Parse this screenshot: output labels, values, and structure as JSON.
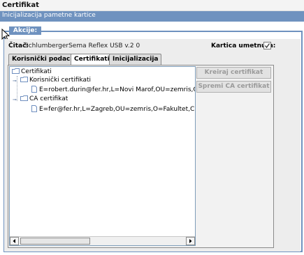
{
  "window": {
    "title": "Certifikat"
  },
  "header": {
    "title": "Inicijalizacija pametne kartice"
  },
  "group": {
    "label": "Akcije:"
  },
  "reader": {
    "label": "Čitač:",
    "value": "SchlumbergerSema Reflex USB v.2 0"
  },
  "card_inserted": {
    "label": "Kartica umetnuta:",
    "checked": true
  },
  "tabs": [
    {
      "label": "Korisnički podaci",
      "active": false
    },
    {
      "label": "Certifikati",
      "active": true
    },
    {
      "label": "Inicijalizacija",
      "active": false
    }
  ],
  "tree": {
    "root": "Certifikati",
    "user_folder": "Korisnički certifikati",
    "user_cert": "E=robert.durin@fer.hr,L=Novi Marof,OU=zemris,O=fer,C=",
    "ca_folder": "CA certifikat",
    "ca_cert": "E=fer@fer.hr,L=Zagreb,OU=zemris,O=Fakultet,C=HR,CN"
  },
  "buttons": {
    "create_cert": "Kreiraj certifikat",
    "save_ca_cert": "Spremi CA certifikat"
  },
  "colors": {
    "accent": "#6f92bf",
    "folder": "#6f8fbf"
  }
}
